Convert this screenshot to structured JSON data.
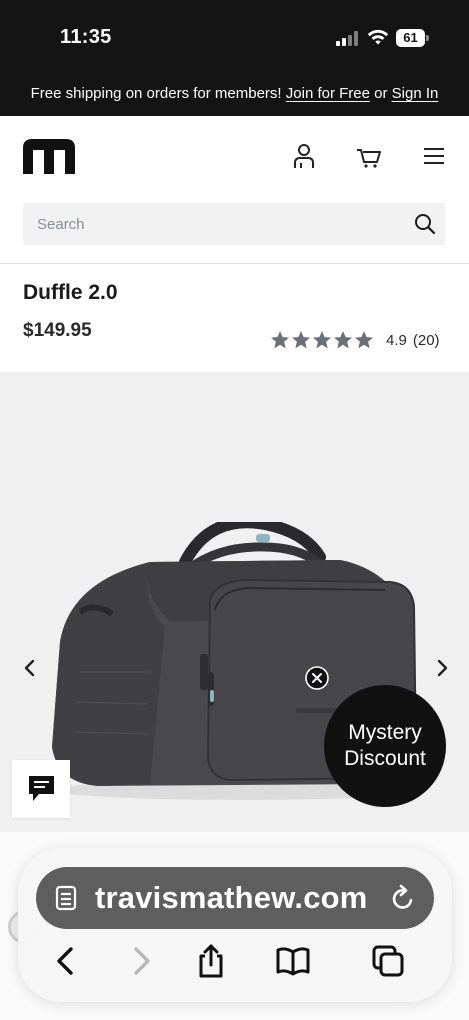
{
  "status_bar": {
    "time": "11:35",
    "battery": "61"
  },
  "promo": {
    "text_before": "Free shipping on orders for members! ",
    "join_link": "Join for Free",
    "middle": " or ",
    "signin_link": "Sign In"
  },
  "header": {
    "search_placeholder": "Search"
  },
  "product": {
    "title": "Duffle 2.0",
    "price": "$149.95",
    "rating_value": "4.9",
    "rating_count": "(20)",
    "stars": 5
  },
  "popup": {
    "mystery_line1": "Mystery",
    "mystery_line2": "Discount"
  },
  "browser": {
    "url": "travismathew.com"
  },
  "colors": {
    "dark_bar": "#141414",
    "star": "#6b6f78",
    "search_bg": "#f2f2f3"
  }
}
